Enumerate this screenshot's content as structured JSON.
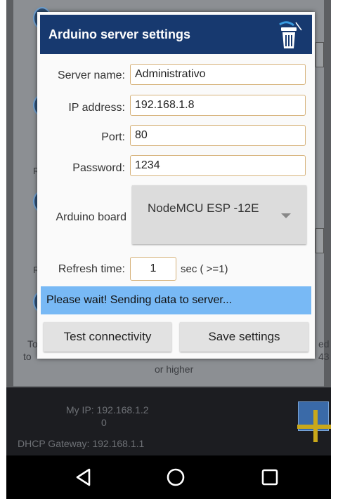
{
  "background": {
    "card_labels": [
      "Re",
      "Re"
    ],
    "footer_left": "To",
    "footer_left2": "to",
    "footer_right": "ed",
    "footer_right2": "43",
    "footer_center": "or higher"
  },
  "status": {
    "my_ip_label": "My IP: 192.168.1.2",
    "my_ip_sub": "0",
    "dhcp_gateway": "DHCP Gateway: 192.168.1.1"
  },
  "dialog": {
    "title": "Arduino server settings",
    "server_name_label": "Server name:",
    "server_name_value": "Administrativo",
    "ip_label": "IP address:",
    "ip_value": "192.168.1.8",
    "port_label": "Port:",
    "port_value": "80",
    "password_label": "Password:",
    "password_value": "1234",
    "board_label": "Arduino board",
    "board_value": "NodeMCU ESP -12E",
    "refresh_label": "Refresh time:",
    "refresh_value": "1",
    "refresh_unit": "sec ( >=1)",
    "status_message": "Please wait! Sending data to server...",
    "test_button": "Test connectivity",
    "save_button": "Save settings"
  },
  "icons": {
    "delete": "trash-icon",
    "nav_back": "back-triangle-icon",
    "nav_home": "home-circle-icon",
    "nav_recents": "recents-square-icon"
  },
  "colors": {
    "header": "#17396f",
    "status_bar": "#78b9f5",
    "field_border": "#d6b27a"
  }
}
